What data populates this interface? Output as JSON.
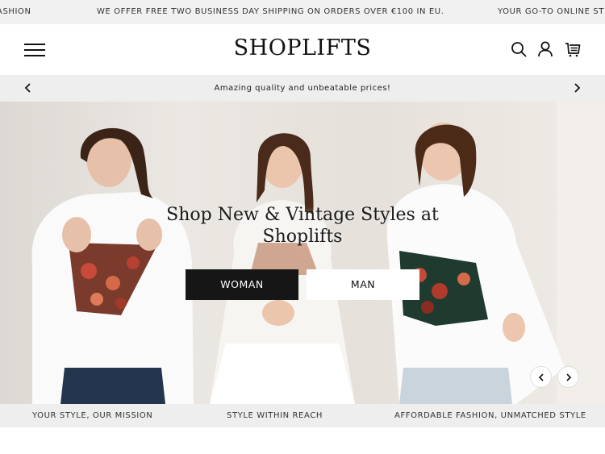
{
  "marquee": {
    "items": [
      "ASHION",
      "WE OFFER FREE TWO BUSINESS DAY SHIPPING ON ORDERS OVER €100 IN EU.",
      "YOUR GO-TO ONLINE ST"
    ]
  },
  "header": {
    "logo": "SHOPLIFTS",
    "icons": [
      "menu-icon",
      "search-icon",
      "user-icon",
      "cart-icon"
    ]
  },
  "announcement": {
    "message": "Amazing quality and unbeatable prices!"
  },
  "hero": {
    "title_line1": "Shop New & Vintage Styles at",
    "title_line2": "Shoplifts",
    "buttons": {
      "woman": "WOMAN",
      "man": "MAN"
    }
  },
  "features": {
    "items": [
      "YOUR STYLE, OUR MISSION",
      "STYLE WITHIN REACH",
      "AFFORDABLE FASHION, UNMATCHED STYLE"
    ]
  },
  "colors": {
    "topbar_bg": "#f1f1f1",
    "announce_bg": "#eeeeee",
    "primary_button": "#161616",
    "text": "#111111"
  }
}
